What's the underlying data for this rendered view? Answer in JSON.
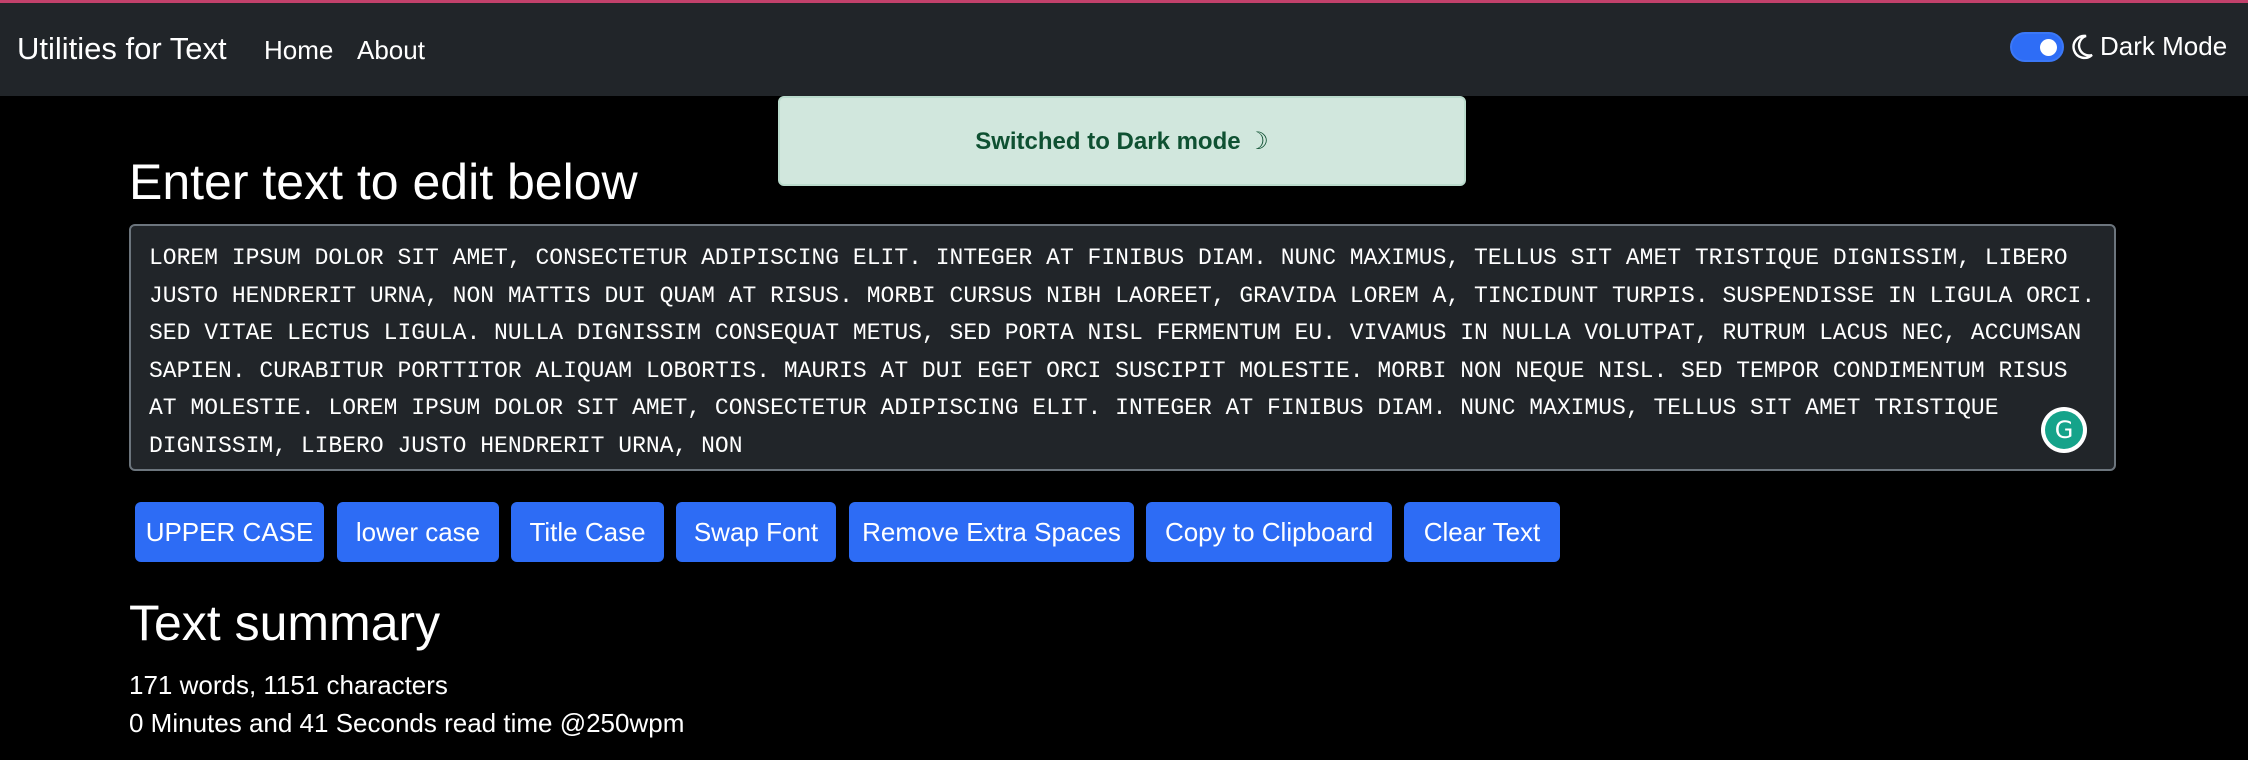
{
  "navbar": {
    "brand": "Utilities for Text",
    "links": [
      "Home",
      "About"
    ],
    "dark_mode_label": "Dark Mode",
    "dark_mode_on": true
  },
  "alert": {
    "message": "Switched to Dark mode ☽"
  },
  "editor": {
    "heading": "Enter text to edit below",
    "text": "LOREM IPSUM DOLOR SIT AMET, CONSECTETUR ADIPISCING ELIT. INTEGER AT FINIBUS DIAM. NUNC MAXIMUS, TELLUS SIT AMET TRISTIQUE DIGNISSIM, LIBERO JUSTO HENDRERIT URNA, NON MATTIS DUI QUAM AT RISUS. MORBI CURSUS NIBH LAOREET, GRAVIDA LOREM A, TINCIDUNT TURPIS. SUSPENDISSE IN LIGULA ORCI. SED VITAE LECTUS LIGULA. NULLA DIGNISSIM CONSEQUAT METUS, SED PORTA NISL FERMENTUM EU. VIVAMUS IN NULLA VOLUTPAT, RUTRUM LACUS NEC, ACCUMSAN SAPIEN. CURABITUR PORTTITOR ALIQUAM LOBORTIS. MAURIS AT DUI EGET ORCI SUSCIPIT MOLESTIE. MORBI NON NEQUE NISL. SED TEMPOR CONDIMENTUM RISUS AT MOLESTIE. LOREM IPSUM DOLOR SIT AMET, CONSECTETUR ADIPISCING ELIT. INTEGER AT FINIBUS DIAM. NUNC MAXIMUS, TELLUS SIT AMET TRISTIQUE DIGNISSIM, LIBERO JUSTO HENDRERIT URNA, NON"
  },
  "buttons": {
    "upper": "UPPER CASE",
    "lower": "lower case",
    "title": "Title Case",
    "swap": "Swap Font",
    "remove_spaces": "Remove Extra Spaces",
    "copy": "Copy to Clipboard",
    "clear": "Clear Text"
  },
  "summary": {
    "heading": "Text summary",
    "counts": "171 words, 1151 characters",
    "read_time": "0 Minutes and 41 Seconds read time @250wpm"
  },
  "colors": {
    "navbar_bg": "#212529",
    "page_bg": "#000000",
    "accent": "#2d6cf5",
    "alert_bg": "#d1e7dd",
    "alert_text": "#0f5132"
  },
  "icons": [
    "moon-icon",
    "grammarly-icon"
  ]
}
